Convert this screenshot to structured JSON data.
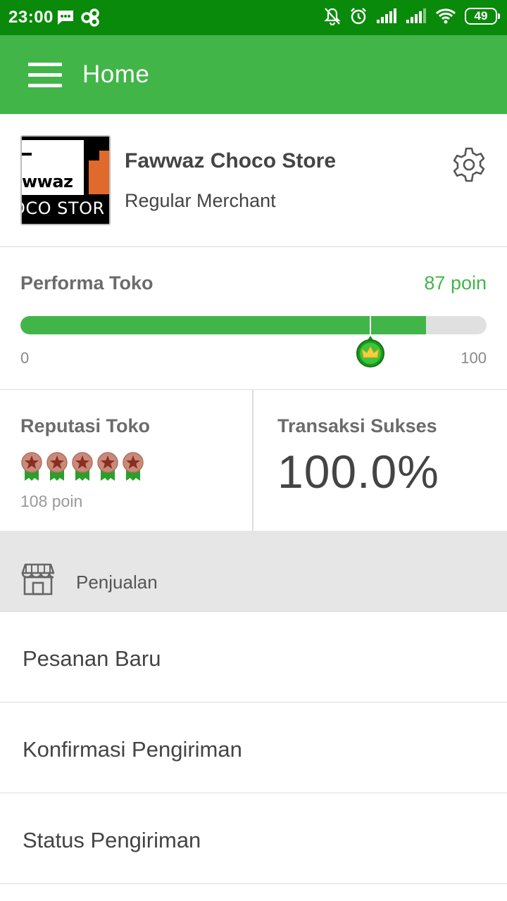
{
  "status_bar": {
    "time": "23:00",
    "battery": "49",
    "icons": [
      "message-icon",
      "loop-icon",
      "mute-bell-icon",
      "alarm-icon",
      "signal-icon",
      "signal-icon",
      "wifi-icon",
      "battery-icon"
    ]
  },
  "app_bar": {
    "title": "Home",
    "menu_icon": "hamburger-menu-icon"
  },
  "store": {
    "logo_text_top": "wwaz",
    "logo_text_bottom": "OCO STOR",
    "name": "Fawwaz Choco Store",
    "type": "Regular Merchant",
    "settings_icon": "gear-icon"
  },
  "performance": {
    "label": "Performa Toko",
    "value_text": "87 poin",
    "value": 87,
    "marker_value": 75,
    "min": "0",
    "max": "100",
    "colors": {
      "fill": "#42b549",
      "track": "#e0e0e0"
    }
  },
  "reputation": {
    "label": "Reputasi Toko",
    "medal_count": 5,
    "points": "108 poin"
  },
  "transactions": {
    "label": "Transaksi Sukses",
    "value": "100.0%"
  },
  "section": {
    "icon": "shop-icon",
    "label": "Penjualan"
  },
  "menu": [
    {
      "label": "Pesanan Baru"
    },
    {
      "label": "Konfirmasi Pengiriman"
    },
    {
      "label": "Status Pengiriman"
    }
  ],
  "colors": {
    "status_bar": "#0a8a0a",
    "app_bar": "#42b549",
    "accent": "#42b549"
  }
}
